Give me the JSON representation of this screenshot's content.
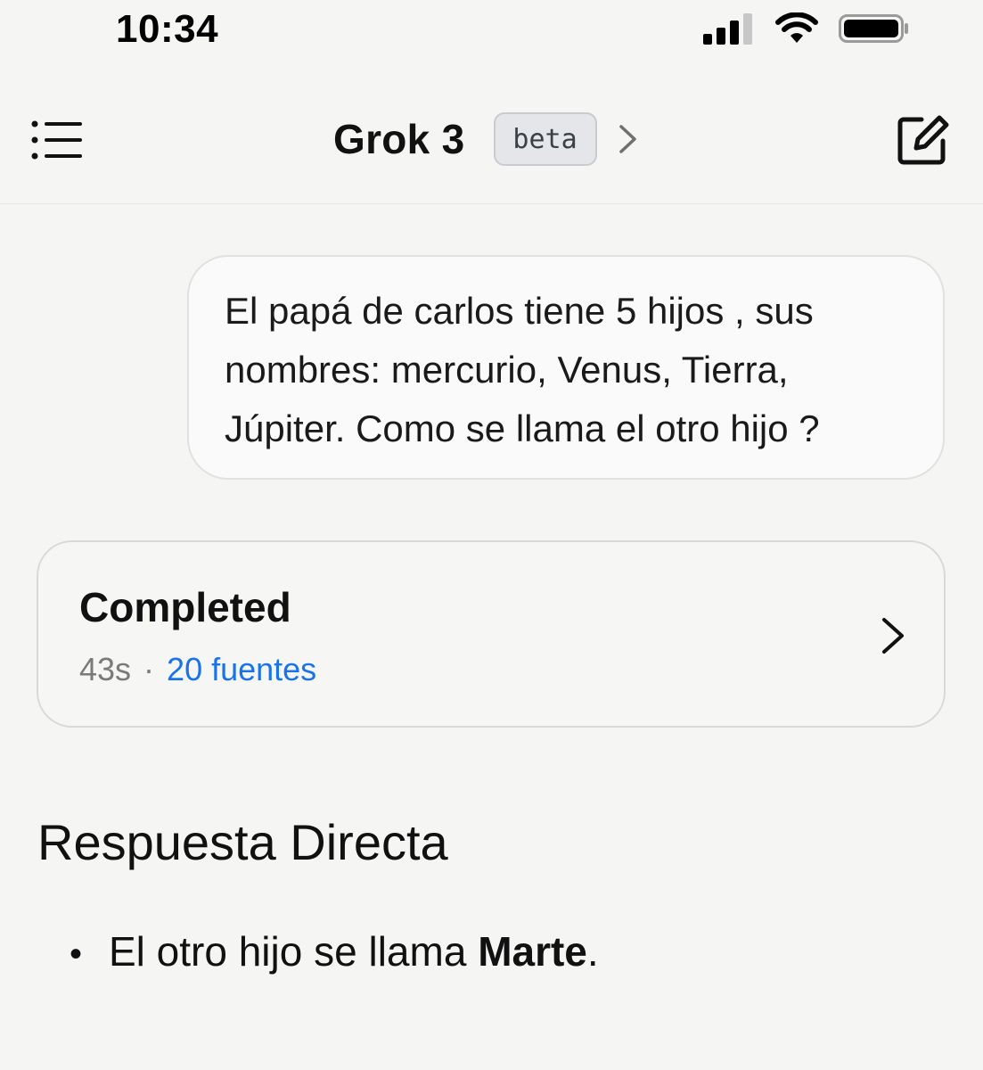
{
  "status_bar": {
    "time": "10:34",
    "icons": [
      "cellular-signal-icon",
      "wifi-icon",
      "battery-icon"
    ]
  },
  "header": {
    "menu_icon": "list-menu-icon",
    "title": "Grok 3",
    "badge": "beta",
    "title_chevron_icon": "chevron-right-icon",
    "compose_icon": "compose-edit-icon"
  },
  "conversation": {
    "user_message": "El papá de carlos tiene 5 hijos , sus nombres: mercurio, Venus, Tierra, Júpiter. Como se llama el otro hijo ?",
    "status_card": {
      "title": "Completed",
      "duration": "43s",
      "separator": "·",
      "sources": "20 fuentes",
      "chevron_icon": "chevron-right-icon"
    },
    "answer": {
      "heading": "Respuesta Directa",
      "bullets": [
        {
          "marker": "•",
          "prefix": "El otro hijo se llama ",
          "emphasis": "Marte",
          "suffix": "."
        }
      ]
    }
  },
  "colors": {
    "background": "#f5f5f4",
    "link": "#1a73e8",
    "muted_text": "#7a7a7a",
    "badge_bg": "#e4e6e9"
  }
}
